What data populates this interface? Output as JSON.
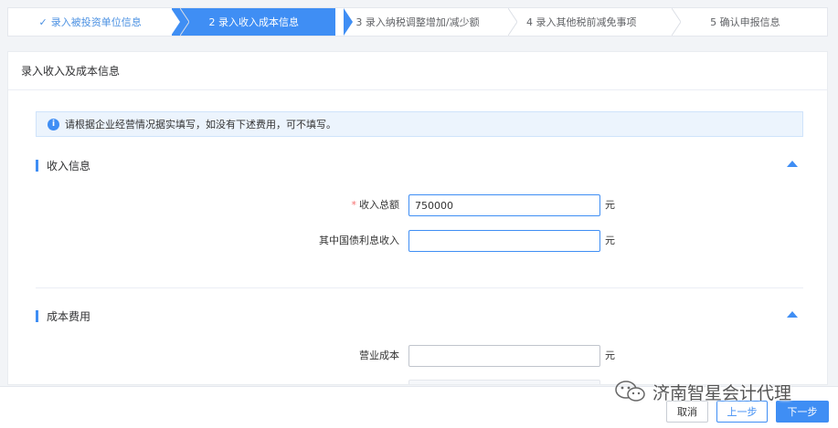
{
  "stepper": {
    "steps": [
      {
        "label": "录入被投资单位信息",
        "state": "done"
      },
      {
        "label": "2 录入收入成本信息",
        "state": "active"
      },
      {
        "label": "3 录入纳税调整增加/减少额",
        "state": "todo"
      },
      {
        "label": "4 录入其他税前减免事项",
        "state": "todo"
      },
      {
        "label": "5 确认申报信息",
        "state": "todo"
      }
    ]
  },
  "card": {
    "title": "录入收入及成本信息",
    "notice": "请根据企业经营情况据实填写，如没有下述费用，可不填写。",
    "income": {
      "title": "收入信息",
      "fields": [
        {
          "label": "收入总额",
          "required": "*",
          "value": "750000",
          "placeholder": "",
          "unit": "元"
        },
        {
          "label": "其中国债利息收入",
          "value": "",
          "placeholder": "",
          "unit": "元"
        }
      ]
    },
    "cost": {
      "title": "成本费用",
      "fields": [
        {
          "label": "营业成本",
          "value": "",
          "placeholder": "",
          "unit": "元"
        }
      ]
    }
  },
  "footer": {
    "cancel_label": "取消",
    "prev_label": "上一步",
    "next_label": "下一步"
  },
  "watermark": {
    "text": "济南智星会计代理",
    "icon": "wechat-icon"
  },
  "colors": {
    "accent": "#3f8ef4",
    "required": "#f56c6c"
  }
}
